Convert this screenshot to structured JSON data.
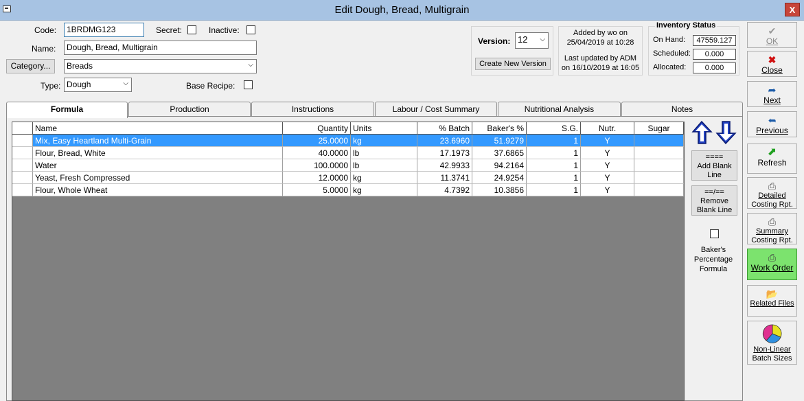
{
  "window": {
    "title": "Edit Dough, Bread, Multigrain",
    "close_label": "X"
  },
  "header": {
    "code_label": "Code:",
    "code_value": "1BRDMG123",
    "secret_label": "Secret:",
    "inactive_label": "Inactive:",
    "name_label": "Name:",
    "name_value": "Dough, Bread, Multigrain",
    "category_button": "Category...",
    "category_value": "Breads",
    "type_label": "Type:",
    "type_value": "Dough",
    "base_recipe_label": "Base Recipe:"
  },
  "version": {
    "label": "Version:",
    "value": "12",
    "create_button": "Create New Version"
  },
  "audit": {
    "added_line1": "Added by wo on",
    "added_line2": "25/04/2019 at 10:28",
    "updated_line1": "Last updated by ADM",
    "updated_line2": "on 16/10/2019 at 16:05"
  },
  "inventory": {
    "title": "Inventory Status",
    "on_hand_label": "On Hand:",
    "on_hand_value": "47559.127",
    "scheduled_label": "Scheduled:",
    "scheduled_value": "0.000",
    "allocated_label": "Allocated:",
    "allocated_value": "0.000"
  },
  "tabs": [
    "Formula",
    "Production",
    "Instructions",
    "Labour / Cost Summary",
    "Nutritional Analysis",
    "Notes"
  ],
  "grid": {
    "columns": [
      "Name",
      "Quantity",
      "Units",
      "% Batch",
      "Baker's %",
      "S.G.",
      "Nutr.",
      "Sugar"
    ],
    "rows": [
      [
        "Mix, Easy Heartland Multi-Grain",
        "25.0000",
        "kg",
        "23.6960",
        "51.9279",
        "1",
        "Y",
        ""
      ],
      [
        "Flour, Bread, White",
        "40.0000",
        "lb",
        "17.1973",
        "37.6865",
        "1",
        "Y",
        ""
      ],
      [
        "Water",
        "100.0000",
        "lb",
        "42.9933",
        "94.2164",
        "1",
        "Y",
        ""
      ],
      [
        "Yeast, Fresh Compressed",
        "12.0000",
        "kg",
        "11.3741",
        "24.9254",
        "1",
        "Y",
        ""
      ],
      [
        "Flour, Whole Wheat",
        "5.0000",
        "kg",
        "4.7392",
        "10.3856",
        "1",
        "Y",
        ""
      ]
    ]
  },
  "grid_tools": {
    "add_blank_sym": "====",
    "add_blank_line1": "Add Blank",
    "add_blank_line2": "Line",
    "remove_blank_sym": "==/==",
    "remove_blank_line1": "Remove",
    "remove_blank_line2": "Blank Line",
    "bakers_line1": "Baker's",
    "bakers_line2": "Percentage",
    "bakers_line3": "Formula"
  },
  "side_buttons": {
    "ok": "OK",
    "close": "Close",
    "next": "Next",
    "previous": "Previous",
    "refresh": "Refresh",
    "detailed_1": "Detailed",
    "detailed_2": "Costing Rpt.",
    "summary_1": "Summary",
    "summary_2": "Costing Rpt.",
    "work_order": "Work Order",
    "related_files": "Related Files",
    "nonlinear_1": "Non-Linear",
    "nonlinear_2": "Batch Sizes"
  },
  "colors": {
    "selection": "#3399ff",
    "work_order_bg": "#7ce36e",
    "close_red": "#c7453a"
  }
}
